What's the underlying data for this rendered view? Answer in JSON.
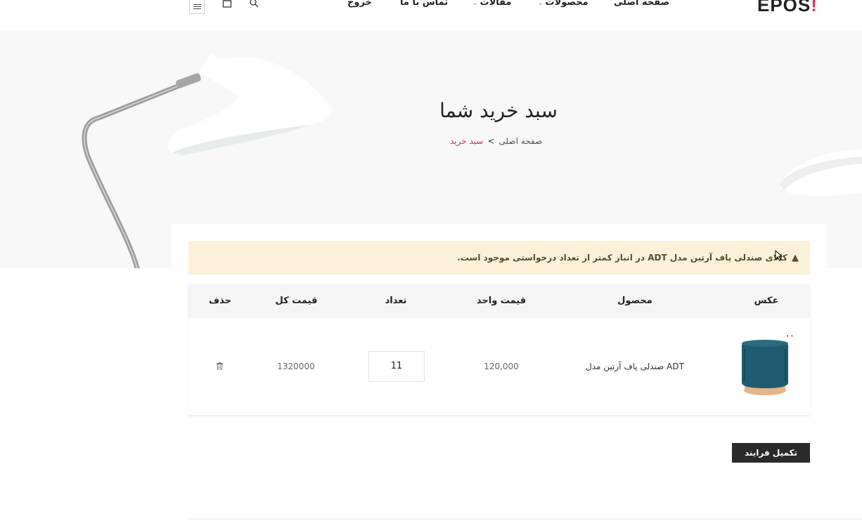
{
  "header": {
    "logo_text": "EPOS",
    "logo_dot": "!",
    "nav": {
      "home": "صفحه اصلی",
      "products": "محصولات",
      "articles": "مقالات",
      "contact": "تماس با ما",
      "logout": "خروج"
    },
    "icons": [
      "menu-icon",
      "cart-icon",
      "search-icon"
    ]
  },
  "hero": {
    "title": "سبد خرید شما",
    "breadcrumb": {
      "home": "صفحه اصلی",
      "separator": ">",
      "current": "سبد خرید"
    }
  },
  "alert": {
    "icon": "warning-icon",
    "text": "کالای صندلی پاف آرتین مدل ADT در انبار کمتر از تعداد درخواستی موجود است."
  },
  "cart_table": {
    "headers": {
      "image": "عکس",
      "product": "محصول",
      "unit_price": "قیمت واحد",
      "quantity": "تعداد",
      "total_price": "قیمت کل",
      "delete": "حذف"
    },
    "rows": [
      {
        "product": "صندلی پاف آرتین مدل ADT",
        "unit_price": "120,000",
        "quantity": "11",
        "total_price": "1320000"
      }
    ]
  },
  "checkout_button": "تکمیل فرایند",
  "colors": {
    "accent": "#c8325c",
    "alert_bg": "#fbf1d9",
    "button_bg": "#2a2a2a",
    "pouf_teal": "#1f5b6e",
    "pouf_base": "#e6b48a"
  }
}
